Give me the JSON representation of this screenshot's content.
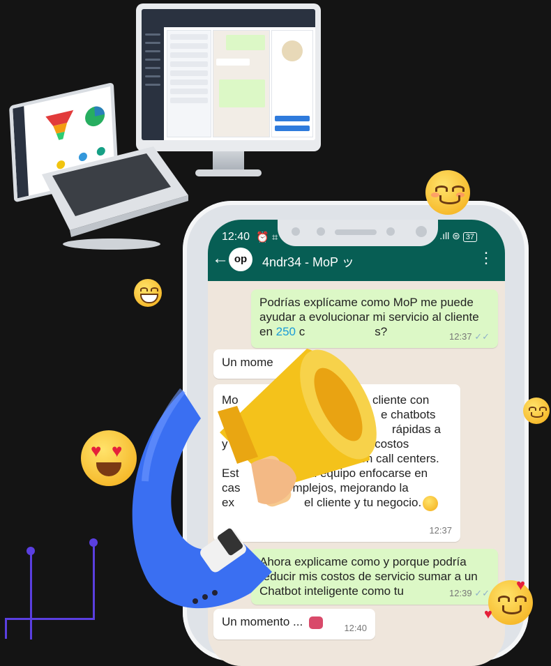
{
  "status": {
    "time": "12:40",
    "battery": "37"
  },
  "chat": {
    "name": "4ndr34 - MoP ッ",
    "avatar_text": "op"
  },
  "messages": [
    {
      "dir": "out",
      "text_before": "Podrías explícame como MoP me puede ayudar a evolucionar mi servicio al cliente en ",
      "highlight": "250",
      "text_after": " c",
      "tail": "s?",
      "time": "12:37"
    },
    {
      "dir": "in",
      "text": "Un mome",
      "time": ""
    },
    {
      "dir": "in",
      "lines": [
        "MoP",
        "cliente con",
        "e chatbots",
        "rápidas a",
        "ndo costos",
        "respuesta en call centers.",
        "a tu equipo enfocarse en",
        "omplejos, mejorando la",
        "el cliente y tu negocio."
      ],
      "line_prefixes": [
        "Mo",
        "",
        "",
        "",
        "y",
        "Est",
        "cas",
        "ex"
      ],
      "time": "12:37"
    },
    {
      "dir": "out",
      "text": "Ahora explicame como y porque podría reducir mis costos de servicio sumar a un Chatbot inteligente como tu",
      "time": "12:39"
    },
    {
      "dir": "in",
      "text": "Un momento ...",
      "time": "12:40"
    }
  ],
  "colors": {
    "header": "#075e54",
    "out_bubble": "#dcf8c6",
    "in_bubble": "#ffffff",
    "accent": "#5a3fe0"
  },
  "icons": [
    "back-arrow-icon",
    "menu-dots-icon",
    "robot-icon",
    "smile-emoji-icon",
    "heart-eyes-emoji-icon",
    "megaphone-icon"
  ]
}
